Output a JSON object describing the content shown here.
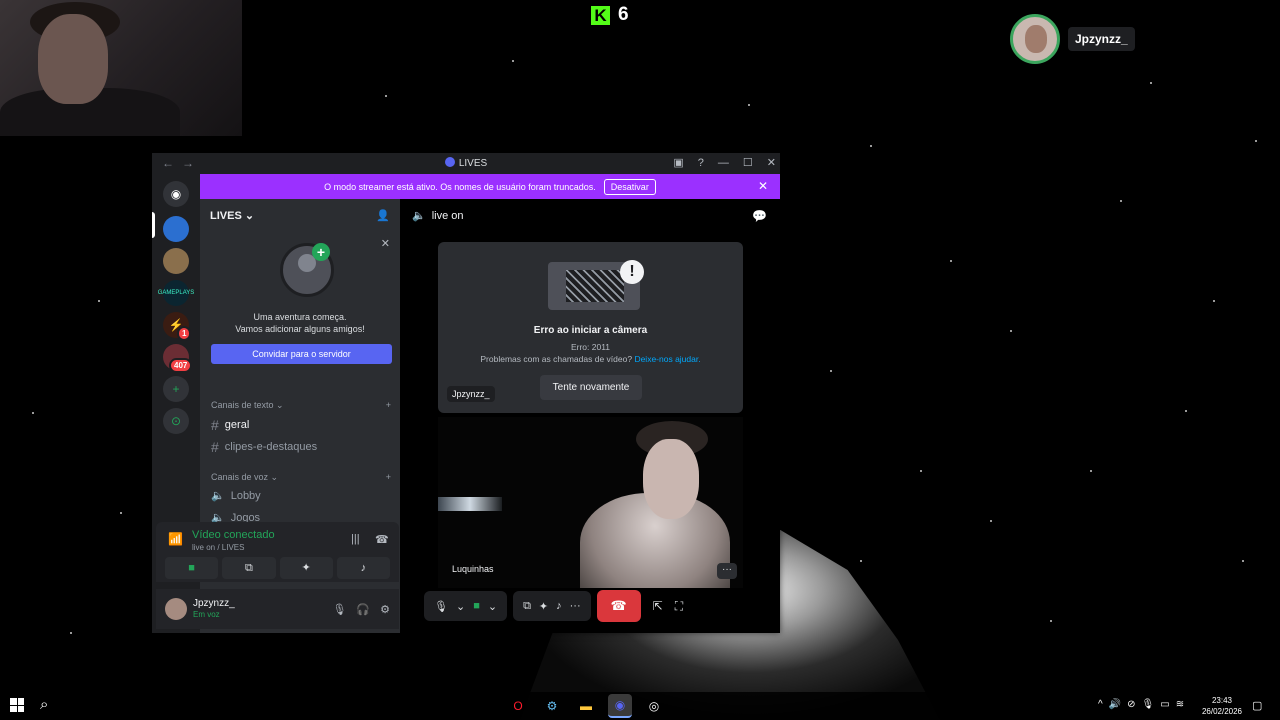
{
  "overlay": {
    "kick_count": "6",
    "streamer_name": "Jpzynzz_"
  },
  "window": {
    "title": "LIVES",
    "colors": {
      "accent": "#5865f2",
      "success": "#23a559",
      "danger": "#da373c",
      "streamer_banner": "#9b30ff"
    }
  },
  "banner": {
    "text": "O modo streamer está ativo. Os nomes de usuário foram truncados.",
    "button": "Desativar"
  },
  "guilds": {
    "badges": [
      "1",
      "407"
    ]
  },
  "server": {
    "name": "LIVES",
    "invite": {
      "line1": "Uma aventura começa.",
      "line2": "Vamos adicionar alguns amigos!",
      "button": "Convidar para o servidor"
    },
    "text_category": "Canais de texto",
    "text_channels": [
      "geral",
      "clipes-e-destaques"
    ],
    "voice_category": "Canais de voz",
    "voice_channels": [
      "Lobby",
      "Jogos"
    ]
  },
  "voice_panel": {
    "status": "Vídeo conectado",
    "location": "live on / LIVES"
  },
  "user": {
    "name": "Jpzynzz_",
    "status": "Em voz"
  },
  "call": {
    "channel": "live on",
    "error_title": "Erro ao iniciar a câmera",
    "error_code": "Erro: 2011",
    "error_desc": "Problemas com as chamadas de vídeo?",
    "error_link": "Deixe-nos ajudar.",
    "retry": "Tente novamente",
    "tile1_name": "Jpzynzz_",
    "tile2_name": "Luquinhas"
  },
  "taskbar": {
    "time": "23:43",
    "date": "26/02/2026"
  }
}
